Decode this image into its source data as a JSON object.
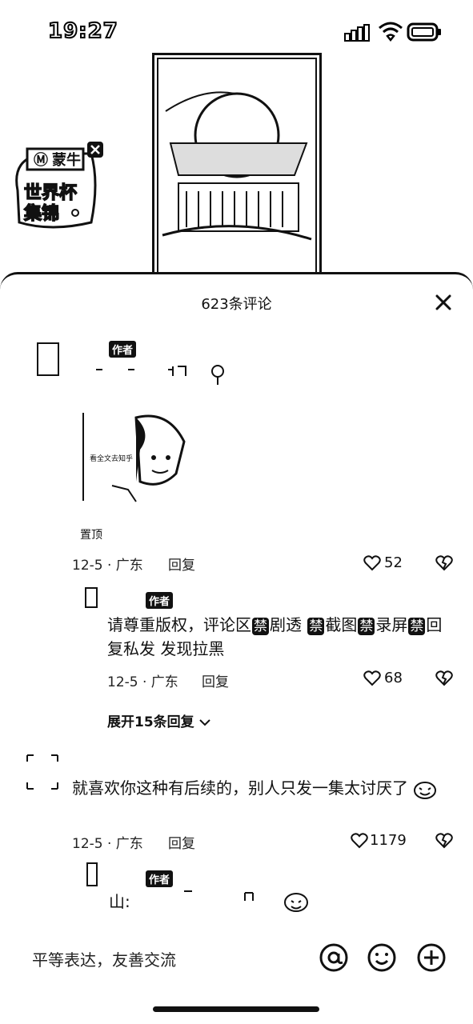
{
  "status_bar": {
    "time": "19:27"
  },
  "promo_badge": {
    "label_top": "蒙牛",
    "label_bottom": "世界杯\n集锦"
  },
  "comments_sheet": {
    "title": "623条评论",
    "comments": [
      {
        "author_tag": "作者",
        "sticker_text": "看全文去知乎",
        "pinned_label": "置顶",
        "date_location": "12-5 · 广东",
        "reply_label": "回复",
        "likes": "52"
      },
      {
        "author_tag": "作者",
        "text_parts": [
          "请尊重版权，评论区",
          "禁",
          "剧透 ",
          "禁",
          "截图",
          "禁",
          "录屏",
          "禁",
          "回复私发 发现拉黑"
        ],
        "date_location": "12-5 · 广东",
        "reply_label": "回复",
        "likes": "68"
      },
      {
        "expand_label": "展开15条回复"
      },
      {
        "text": "就喜欢你这种有后续的，别人只发一集太讨厌了",
        "date_location": "12-5 · 广东",
        "reply_label": "回复",
        "likes": "1179"
      },
      {
        "author_tag": "作者",
        "text": "山:"
      }
    ]
  },
  "input_bar": {
    "placeholder": "平等表达，友善交流"
  },
  "icons": [
    "signal-icon",
    "wifi-icon",
    "battery-icon",
    "close-icon",
    "heart-icon",
    "dislike-icon",
    "chevron-down-icon",
    "at-icon",
    "emoji-icon",
    "add-icon"
  ]
}
